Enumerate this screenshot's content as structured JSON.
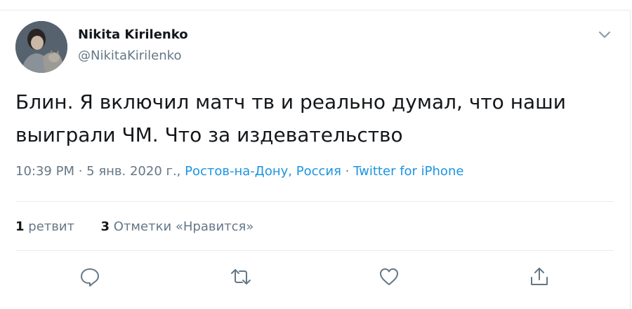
{
  "user": {
    "name": "Nikita Kirilenko",
    "handle": "@NikitaKirilenko"
  },
  "tweet": {
    "text_line1": "Блин. Я включил матч тв и реально думал, что наши",
    "text_line2": "выиграли ЧМ. Что за издевательство"
  },
  "meta": {
    "time_date": "10:39 PM · 5 янв. 2020 г.,",
    "location": "Ростов-на-Дону, Россия",
    "separator": "·",
    "source": "Twitter for iPhone"
  },
  "stats": {
    "retweets_count": "1",
    "retweets_label": "ретвит",
    "likes_count": "3",
    "likes_label": "Отметки «Нравится»"
  },
  "icons": {
    "more": "chevron-down-icon",
    "reply": "reply-icon",
    "retweet": "retweet-icon",
    "like": "heart-icon",
    "share": "share-icon"
  },
  "colors": {
    "link": "#1b95e0",
    "secondary_text": "#657786",
    "primary_text": "#14171a",
    "divider": "#e6ecf0"
  }
}
